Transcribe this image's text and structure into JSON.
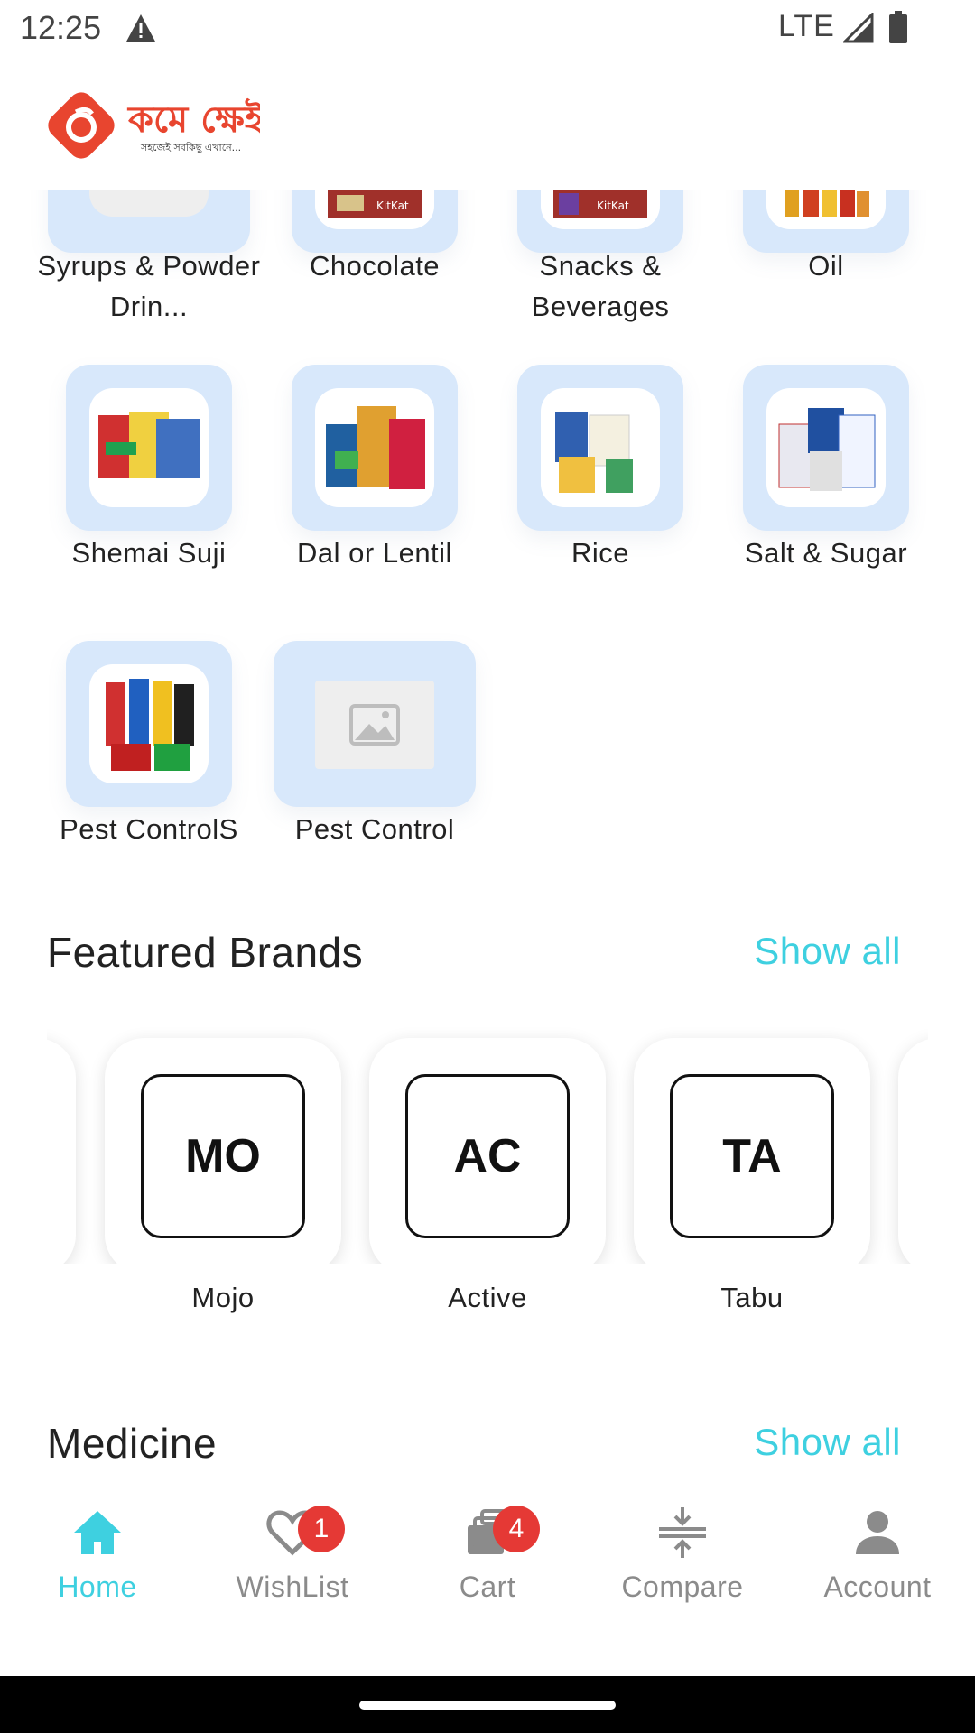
{
  "status_bar": {
    "time": "12:25",
    "network": "LTE"
  },
  "header": {
    "logo_text": "কমে ক্ষেই",
    "logo_tagline": "সহজেই সবকিছু এখানে..."
  },
  "categories": [
    {
      "label": "Syrups & Powder Drin..."
    },
    {
      "label": "Chocolate"
    },
    {
      "label": "Snacks & Beverages"
    },
    {
      "label": "Oil"
    },
    {
      "label": "Shemai Suji"
    },
    {
      "label": "Dal or Lentil"
    },
    {
      "label": "Rice"
    },
    {
      "label": "Salt & Sugar"
    },
    {
      "label": "Pest ControlS"
    },
    {
      "label": "Pest Control"
    }
  ],
  "featured_brands": {
    "title": "Featured Brands",
    "show_all": "Show all",
    "brands": [
      {
        "initials": "MO",
        "name": "Mojo"
      },
      {
        "initials": "AC",
        "name": "Active"
      },
      {
        "initials": "TA",
        "name": "Tabu"
      }
    ]
  },
  "medicine": {
    "title": "Medicine",
    "show_all": "Show all"
  },
  "bottom_nav": {
    "items": [
      {
        "label": "Home",
        "icon": "home-icon",
        "active": true
      },
      {
        "label": "WishList",
        "icon": "heart-icon",
        "badge": "1"
      },
      {
        "label": "Cart",
        "icon": "cart-icon",
        "badge": "4"
      },
      {
        "label": "Compare",
        "icon": "compare-icon"
      },
      {
        "label": "Account",
        "icon": "account-icon"
      }
    ]
  },
  "colors": {
    "accent": "#3ed0e0",
    "tile": "#d8e8fb",
    "badge": "#e53935",
    "brand_red": "#e8452f"
  }
}
